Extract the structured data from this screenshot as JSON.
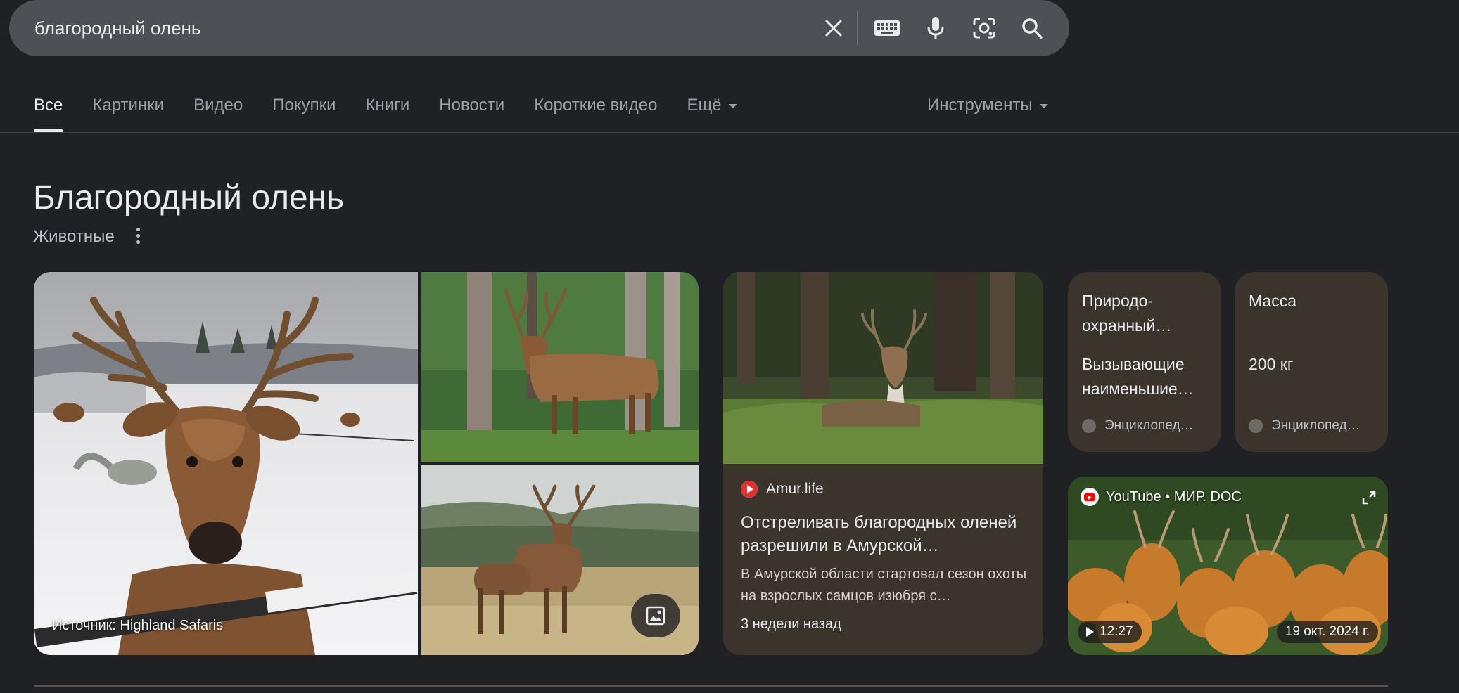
{
  "search": {
    "query": "благородный олень",
    "icons": [
      "close-icon",
      "keyboard-icon",
      "mic-icon",
      "lens-icon",
      "search-icon"
    ]
  },
  "tabs": [
    {
      "label": "Все",
      "active": true
    },
    {
      "label": "Картинки"
    },
    {
      "label": "Видео"
    },
    {
      "label": "Покупки"
    },
    {
      "label": "Книги"
    },
    {
      "label": "Новости"
    },
    {
      "label": "Короткие видео"
    },
    {
      "label": "Ещё"
    }
  ],
  "tools_label": "Инструменты",
  "entity": {
    "title": "Благородный олень",
    "subtitle": "Животные"
  },
  "images": {
    "source_label": "Источник: Highland Safaris"
  },
  "news": {
    "source": "Amur.life",
    "title": "Отстреливать благородных оленей разрешили в Амурской…",
    "snippet": "В Амурской области стартовал сезон охоты на взрослых самцов изюбря с…",
    "time": "3 недели назад"
  },
  "facts": [
    {
      "label": "Природо-охранный…",
      "value": "Вызывающие наименьшие…",
      "source": "Энциклопед…"
    },
    {
      "label": "Масса",
      "value": "200 кг",
      "source": "Энциклопед…"
    }
  ],
  "video": {
    "source": "YouTube • МИР. DOC",
    "duration": "12:27",
    "date": "19 окт. 2024 г."
  },
  "colors": {
    "background": "#202124",
    "search_bar": "#4d5156",
    "card_brown": "#3b342c",
    "text_primary": "#e8eaed",
    "text_secondary": "#9aa0a6"
  }
}
